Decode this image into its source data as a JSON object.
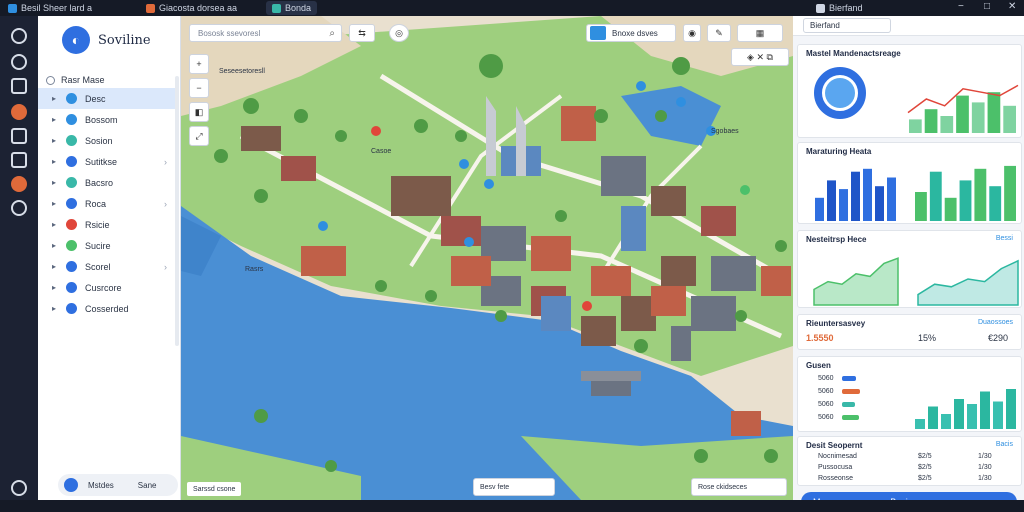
{
  "titlebar": {
    "tabs": [
      {
        "label": "Besil Sheer lard a",
        "icon": "app-icon"
      },
      {
        "label": "Giacosta dorsea aa",
        "icon": "doc-icon"
      },
      {
        "label": "Bonda",
        "icon": "map-icon"
      }
    ],
    "right_tab": "Bierfand",
    "controls": [
      "−",
      "□",
      "✕"
    ]
  },
  "sidebar": {
    "brand": "Soviline",
    "root_label": "Rasr Mase",
    "items": [
      {
        "label": "Desc",
        "color": "#2f8fe0",
        "selected": true
      },
      {
        "label": "Bossom",
        "color": "#2f8fe0"
      },
      {
        "label": "Sosion",
        "color": "#39b8a8"
      },
      {
        "label": "Sutitkse",
        "color": "#2f6fe0"
      },
      {
        "label": "Bacsro",
        "color": "#39b8a8"
      },
      {
        "label": "Roca",
        "color": "#2f6fe0"
      },
      {
        "label": "Rsicie",
        "color": "#e0463a"
      },
      {
        "label": "Sucire",
        "color": "#4cc06a"
      },
      {
        "label": "Scorel",
        "color": "#2f6fe0"
      },
      {
        "label": "Cusrcore",
        "color": "#2f6fe0"
      },
      {
        "label": "Cosserded",
        "color": "#2f6fe0"
      }
    ],
    "footer": {
      "left": "Mstdes",
      "right": "Sane"
    }
  },
  "map": {
    "search_placeholder": "Bososk ssevoresl",
    "chip_label": "Bnoxe dsves",
    "bottom_left": "Sarssd csone",
    "bottom_mid": "Besv fete",
    "bottom_right": "Rose ckidseces",
    "labels": [
      "Seseesetoresll",
      "Casoe",
      "Sgobaes",
      "Rasrs"
    ]
  },
  "panel": {
    "cards": [
      {
        "title": "Mastel Mandenactsreage",
        "link": ""
      },
      {
        "title": "Maraturing Heata",
        "link": ""
      },
      {
        "title": "Nesteitrsp Hece",
        "link": "Bessi"
      },
      {
        "title": "Rieuntersasvey",
        "link": "Duaossoes"
      },
      {
        "title": "Gusen",
        "link": ""
      },
      {
        "title": "Desit Seopernt",
        "link": "Bacis"
      }
    ],
    "kpis": {
      "a": "1.5550",
      "b": "15%",
      "c": "€290"
    },
    "rows": [
      {
        "label": "5060",
        "w": 0.6
      },
      {
        "label": "5060",
        "w": 0.75
      },
      {
        "label": "5060",
        "w": 0.55
      },
      {
        "label": "5060",
        "w": 0.7
      }
    ],
    "legend_rows": [
      {
        "name": "Nocnimesad",
        "v1": "$2/5",
        "v2": "1/30"
      },
      {
        "name": "Pussocusa",
        "v1": "$2/5",
        "v2": "1/30"
      },
      {
        "name": "Rosseonse",
        "v1": "$2/5",
        "v2": "1/30"
      }
    ],
    "primary_button": "Besienne",
    "primary_button_left": "Me"
  },
  "chart_data": [
    {
      "type": "bar",
      "series": [
        {
          "values": [
            20,
            35,
            25,
            55,
            45,
            60,
            40
          ]
        }
      ],
      "lines": [
        {
          "values": [
            30,
            50,
            40,
            65,
            60,
            55,
            70
          ]
        }
      ]
    },
    {
      "type": "bar",
      "series": [
        {
          "values": [
            40,
            70,
            55,
            85,
            90,
            60,
            75
          ]
        }
      ]
    },
    {
      "type": "bar",
      "series": [
        {
          "values": [
            50,
            85,
            40,
            70,
            90,
            60,
            95
          ]
        }
      ]
    },
    {
      "type": "area",
      "series": [
        {
          "values": [
            30,
            45,
            40,
            60,
            55,
            80,
            90
          ]
        }
      ]
    },
    {
      "type": "area",
      "series": [
        {
          "values": [
            20,
            40,
            35,
            50,
            45,
            70,
            85
          ]
        }
      ]
    },
    {
      "type": "bar",
      "series": [
        {
          "values": [
            20,
            45,
            30,
            60,
            50,
            75,
            55,
            80
          ]
        }
      ]
    }
  ]
}
